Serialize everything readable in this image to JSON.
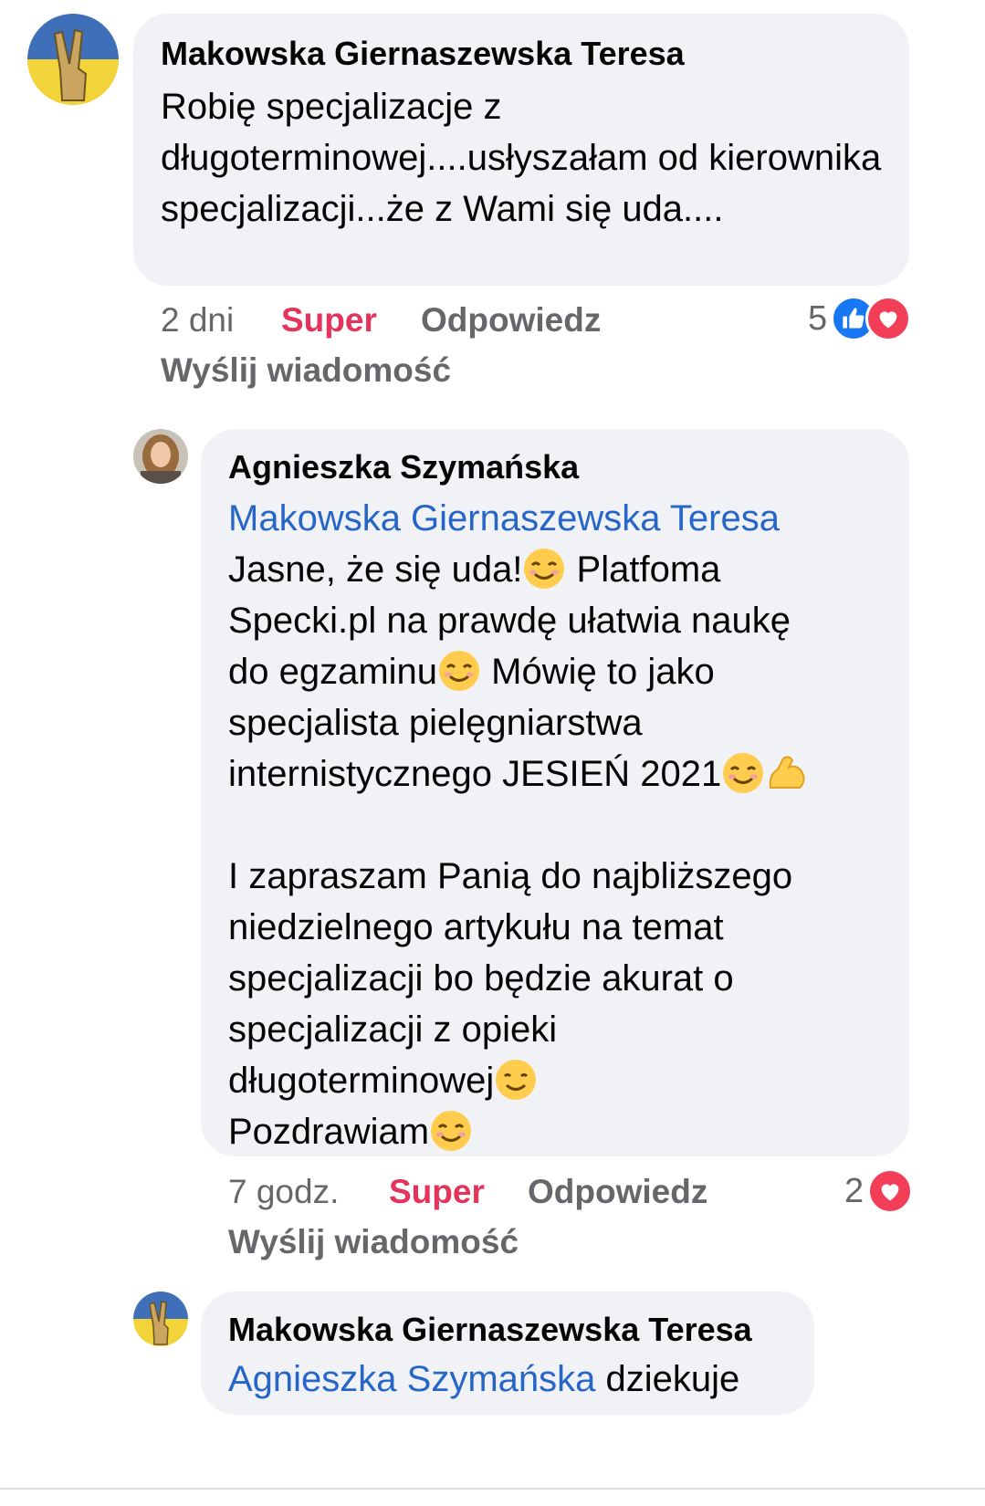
{
  "comments": [
    {
      "author": "Makowska Giernaszewska Teresa",
      "text": "Robię specjalizacje z długoterminowej....usłyszałam od kierownika specjalizacji...że z Wami się uda....",
      "time": "2 dni",
      "reaction_label": "Super",
      "reply_label": "Odpowiedz",
      "message_label": "Wyślij wiadomość",
      "reaction_count": "5"
    },
    {
      "author": "Agnieszka Szymańska",
      "mention": "Makowska Giernaszewska Teresa",
      "line1": "Jasne, że się uda!",
      "line1b": " Platfoma",
      "line2": "Specki.pl na prawdę ułatwia naukę",
      "line3": "do egzaminu",
      "line3b": " Mówię to jako",
      "line4": "specjalista pielęgniarstwa",
      "line5": "internistycznego JESIEŃ 2021",
      "para2": "I zapraszam Panią do najbliższego niedzielnego artykułu na temat specjalizacji bo będzie akurat o specjalizacji z opieki",
      "line_dl": "długoterminowej",
      "line_pz": "Pozdrawiam",
      "time": "7 godz.",
      "reaction_label": "Super",
      "reply_label": "Odpowiedz",
      "message_label": "Wyślij wiadomość",
      "reaction_count": "2"
    },
    {
      "author": "Makowska Giernaszewska Teresa",
      "mention": "Agnieszka Szymańska",
      "text": " dziekuje"
    }
  ],
  "colors": {
    "bubble": "#f0f2f5",
    "mention": "#2766c9",
    "super": "#e4345b",
    "meta": "#65676b",
    "like": "#1877f2",
    "love": "#f33e58"
  }
}
